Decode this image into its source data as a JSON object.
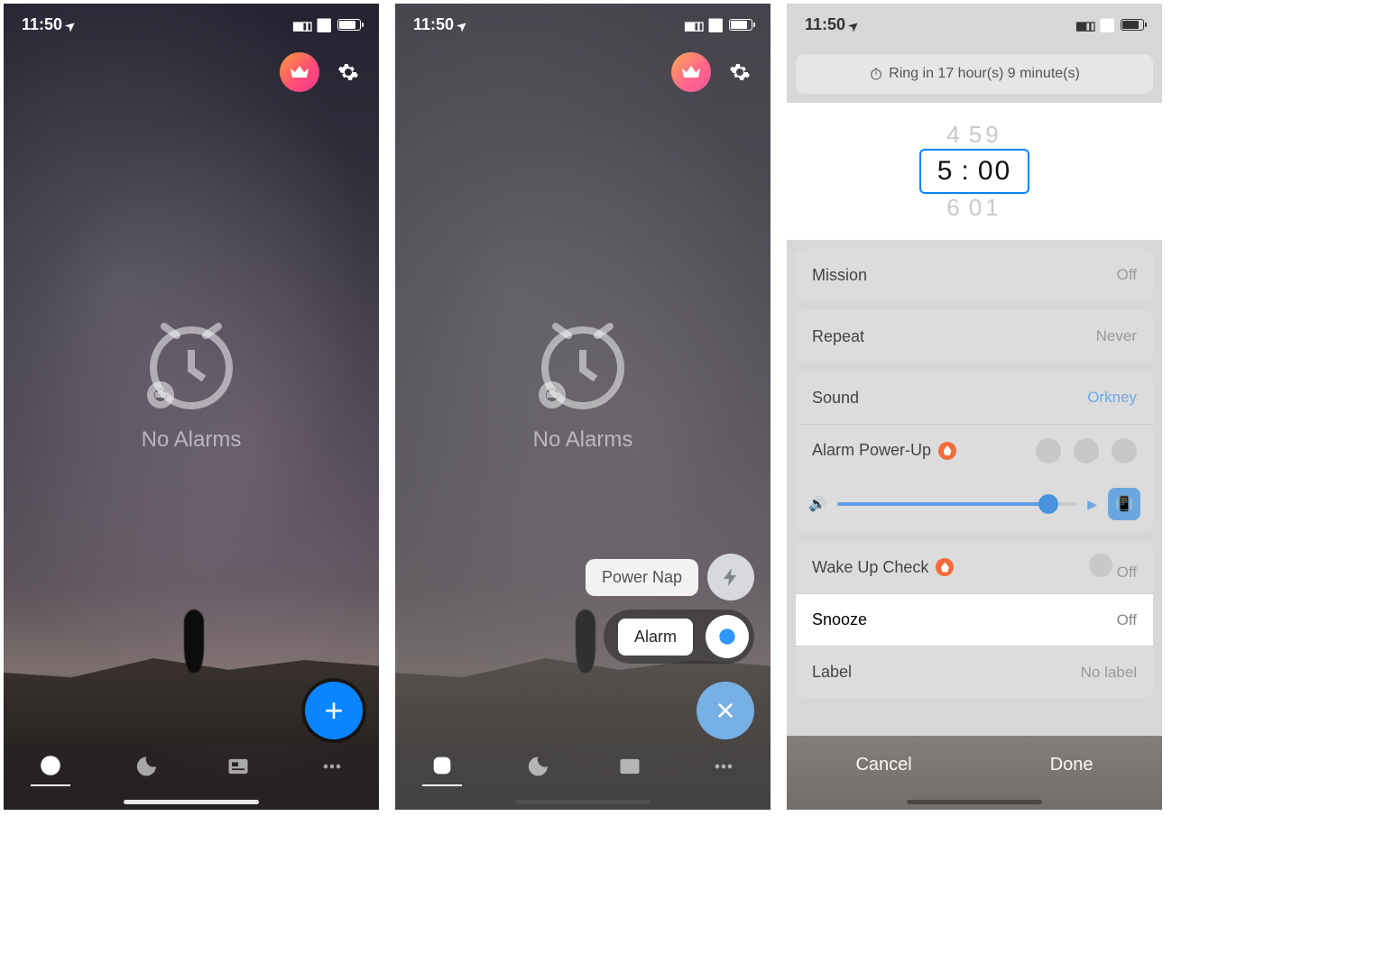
{
  "status": {
    "time": "11:50"
  },
  "screen1": {
    "no_alarms": "No Alarms",
    "fab": "+",
    "tabs": [
      "alarm",
      "sleep",
      "news",
      "more"
    ]
  },
  "screen2": {
    "no_alarms": "No Alarms",
    "option_powernap": "Power Nap",
    "option_alarm": "Alarm",
    "fab_close": "×"
  },
  "screen3": {
    "ring_in": "Ring in 17 hour(s) 9 minute(s)",
    "picker": {
      "prev_h": "4",
      "prev_m": "59",
      "sel_h": "5",
      "sel_m": "00",
      "next_h": "6",
      "next_m": "01"
    },
    "mission": {
      "label": "Mission",
      "value": "Off"
    },
    "repeat": {
      "label": "Repeat",
      "value": "Never"
    },
    "sound": {
      "label": "Sound",
      "value": "Orkney"
    },
    "powerup": {
      "label": "Alarm Power-Up"
    },
    "wakeup": {
      "label": "Wake Up Check",
      "value": "Off"
    },
    "snooze": {
      "label": "Snooze",
      "value": "Off"
    },
    "labelrow": {
      "label": "Label",
      "value": "No label"
    },
    "cancel": "Cancel",
    "done": "Done"
  }
}
